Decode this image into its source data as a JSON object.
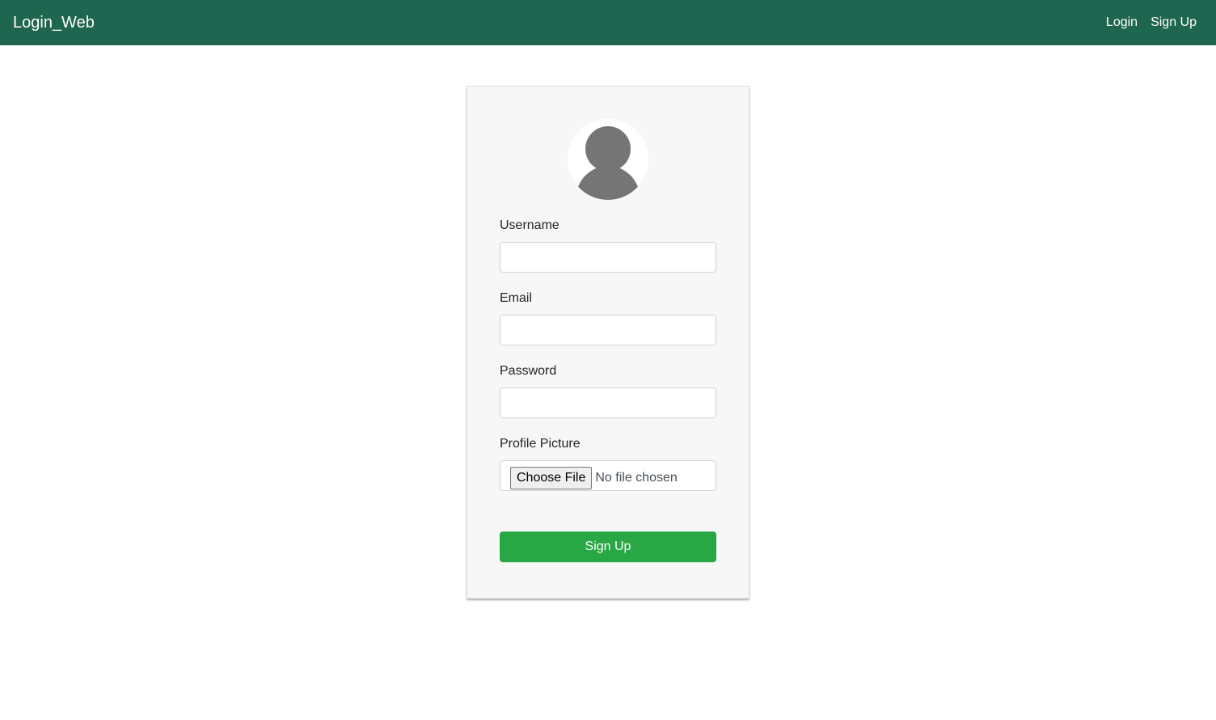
{
  "navbar": {
    "brand": "Login_Web",
    "links": [
      "Login",
      "Sign Up"
    ],
    "background_color": "#1f6650"
  },
  "form": {
    "avatar_icon": "user-avatar-icon",
    "fields": [
      {
        "label": "Username",
        "value": "",
        "placeholder": ""
      },
      {
        "label": "Email",
        "value": "",
        "placeholder": ""
      },
      {
        "label": "Password",
        "value": "",
        "placeholder": ""
      }
    ],
    "file_field": {
      "label": "Profile Picture",
      "button_label": "Choose File",
      "status": "No file chosen"
    },
    "submit_label": "Sign Up",
    "submit_color": "#28a745"
  }
}
